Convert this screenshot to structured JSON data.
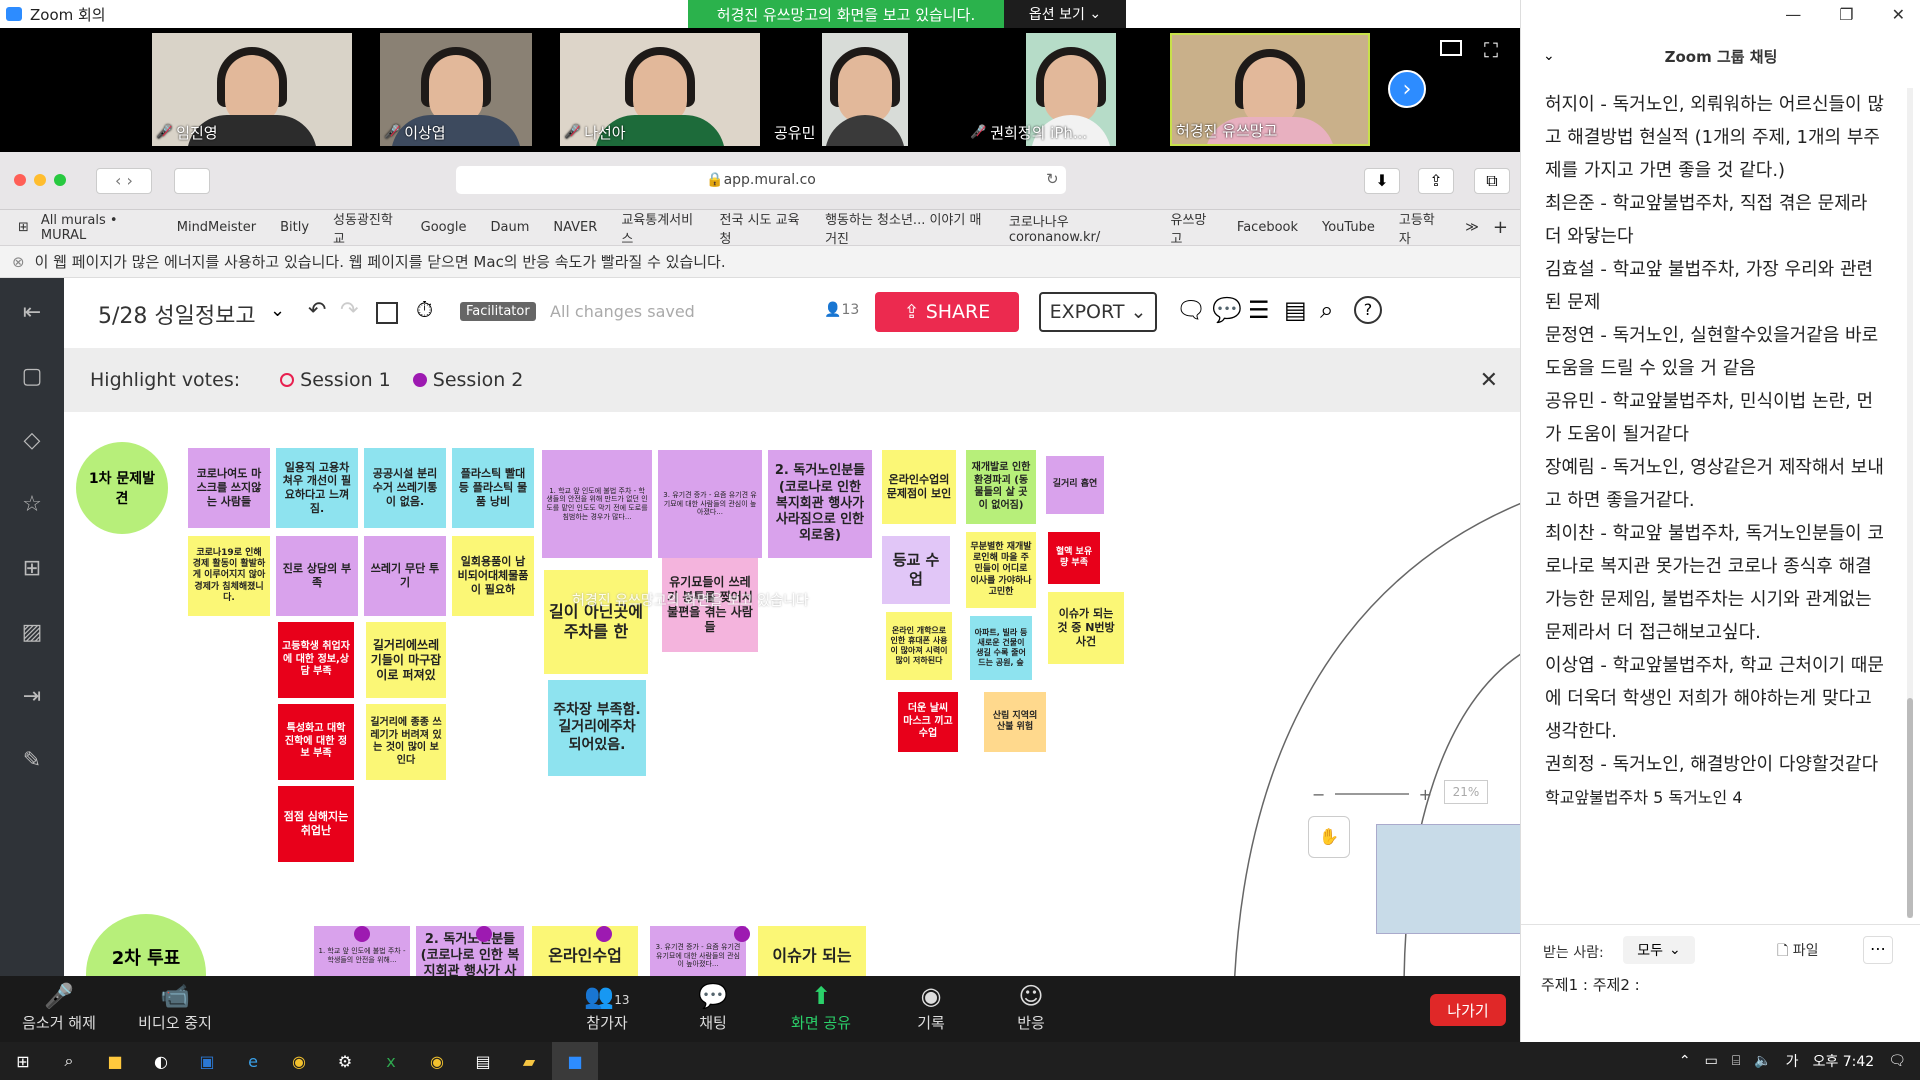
{
  "window": {
    "title": "Zoom 회의",
    "share_banner": "허경진 유쓰망고의 화면을 보고 있습니다.",
    "view_options": "옵션 보기"
  },
  "participants": [
    {
      "name": "임진영",
      "muted": true
    },
    {
      "name": "이상엽",
      "muted": true
    },
    {
      "name": "나선아",
      "muted": true
    },
    {
      "name": "공유민",
      "muted": false
    },
    {
      "name": "권희정의 iPh...",
      "muted": true
    },
    {
      "name": "허경진 유쓰망고",
      "muted": false
    }
  ],
  "browser": {
    "url": "app.mural.co",
    "bookmarks": [
      "All murals • MURAL",
      "MindMeister",
      "Bitly",
      "성동광진학교",
      "Google",
      "Daum",
      "NAVER",
      "교육통계서비스",
      "전국 시도 교육청",
      "행동하는 청소년... 이야기 매거진",
      "코로나나우 coronanow.kr/",
      "유쓰망고",
      "Facebook",
      "YouTube",
      "고등학자"
    ],
    "energy_warning": "이 웹 페이지가 많은 에너지를 사용하고 있습니다. 웹 페이지를 닫으면 Mac의 반응 속도가 빨라질 수 있습니다."
  },
  "mural": {
    "title": "5/28 성일정보고",
    "facilitator": "Facilitator",
    "saved": "All changes saved",
    "user_count": "13",
    "share": "SHARE",
    "export": "EXPORT",
    "votes_label": "Highlight votes:",
    "session1": "Session 1",
    "session2": "Session 2",
    "zoom": "21%",
    "watermark": "허경진 유쓰망고의 화면을 보고 있습니다",
    "first_circle": "1차 문제발견",
    "second_circle": "2차 투표",
    "notes": {
      "n1": "코로나여도 마스크를 쓰지않는 사람들",
      "n2": "일용직 고용차 쳐우 개선이 필요하다고 느껴짐.",
      "n3": "공공시설 분리수거 쓰레기통이 없음.",
      "n4": "플라스틱 빨대 등 플라스틱 물품 낭비",
      "n5": "1. 학교 앞 인도에 불법 주차 - 학생들의 안전을 위해 만드가 없던 인도를 맡인 인도도 막기 전에 도로를 침범하는 경우가 많다...",
      "n6": "3. 유기견 증가 - 요즘 유기견 유기묘에 대한 사람들의 관심이 높아졌다...",
      "n7": "2. 독거노인분들(코로나로 인한 복지회관 행사가 사라짐으로 인한 외로움)",
      "n8": "온라인수업의 문제점이 보인",
      "n9": "재개발로 인한 환경파괴 (동물들의 살 곳이 없어짐)",
      "n10": "길거리 흡연",
      "n11": "코로나19로 인해 경제 활동이 활발하게 이루어지지 않아 경제가 침체해졌니다.",
      "n12": "진로 상담의 부족",
      "n13": "쓰레기 무단 투기",
      "n14": "일회용품이 남비되어대체물품이 필요하",
      "n15": "길이 아닌곳에 주차를 한",
      "n16": "유기묘들이 쓰레기 봉투를 찢어서 불편을 겪는 사람들",
      "n17": "등교 수업",
      "n18": "무분별한 재개발로인해 마을 주민들이 어디로 이사를 가야하나 고민한",
      "n19": "혈액 보유량 부족",
      "n20": "고등학생 취업자에 대한 정보,상담 부족",
      "n21": "길거리에쓰레기들이 마구잡이로 퍼져있",
      "n22": "온라인 개학으로 인한 휴대폰 사용이 많아져 시력이 많이 저하된다",
      "n23": "아파트, 빌라 등 새로운 건물이 생길 수록 줄어드는 공원, 숲",
      "n24": "이슈가 되는 것 중 N번방 사건",
      "n25": "특성화고 대학 진학에 대한 정보 부족",
      "n26": "길거리에 종종 쓰레기가 버려져 있는 것이 많이 보인다",
      "n27": "주차장 부족함. 길거리에주차 되어있음.",
      "n28": "더운 날씨 마스크 끼고 수업",
      "n29": "산림 지역의 산불 위험",
      "n30": "점점 심해지는 취업난",
      "b1": "1. 학교 앞 인도에 불법 주차 - 학생들의 안전을 위해...",
      "b2": "2. 독거노인분들(코로나로 인한 복지회관 행사가 사",
      "b3": "온라인수업",
      "b4": "3. 유기견 증가 - 요즘 유기견 유기묘에 대한 사람들의 관심이 높아졌다...",
      "b5": "이슈가 되는"
    }
  },
  "toolbar": {
    "unmute": "음소거 해제",
    "stop_video": "비디오 중지",
    "participants": "참가자",
    "participants_count": "13",
    "chat": "채팅",
    "share_screen": "화면 공유",
    "record": "기록",
    "reactions": "반응",
    "leave": "나가기"
  },
  "chat": {
    "title": "Zoom 그룹 채팅",
    "messages": [
      "허지이 - 독거노인, 외뤄워하는 어르신들이 많고 해결방법 현실적 (1개의 주제, 1개의 부주제를 가지고 가면 좋을 것 같다.)",
      "최은준 - 학교앞불법주차, 직접 겪은 문제라 더 와닿는다",
      "김효설 - 학교앞 불법주차, 가장 우리와 관련된 문제",
      "문정연 - 독거노인, 실현할수있을거같음 바로 도움을 드릴 수 있을 거 같음",
      "공유민 - 학교앞불법주차, 민식이법 논란, 먼가 도움이 될거같다",
      "장예림 - 독거노인, 영상같은거 제작해서 보내고 하면 좋을거같다.",
      "최이찬 - 학교앞 불법주차, 독거노인분들이 코로나로 복지관 못가는건 코로나 종식후 해결가능한 문제임, 불법주차는 시기와 관계없는 문제라서 더 접근해보고싶다.",
      "이상엽 - 학교앞불법주차, 학교 근처이기 때문에 더욱더 학생인 저희가 해야하는게 맞다고 생각한다.",
      "권희정 - 독거노인, 해결방안이 다양할것같다",
      "학교앞불법주차 5 독거노인 4"
    ],
    "to_label": "받는 사람:",
    "to_value": "모두",
    "file": "파일",
    "input": "주제1 : 주제2 :"
  },
  "taskbar": {
    "time": "오후 7:42",
    "ime": "가"
  }
}
